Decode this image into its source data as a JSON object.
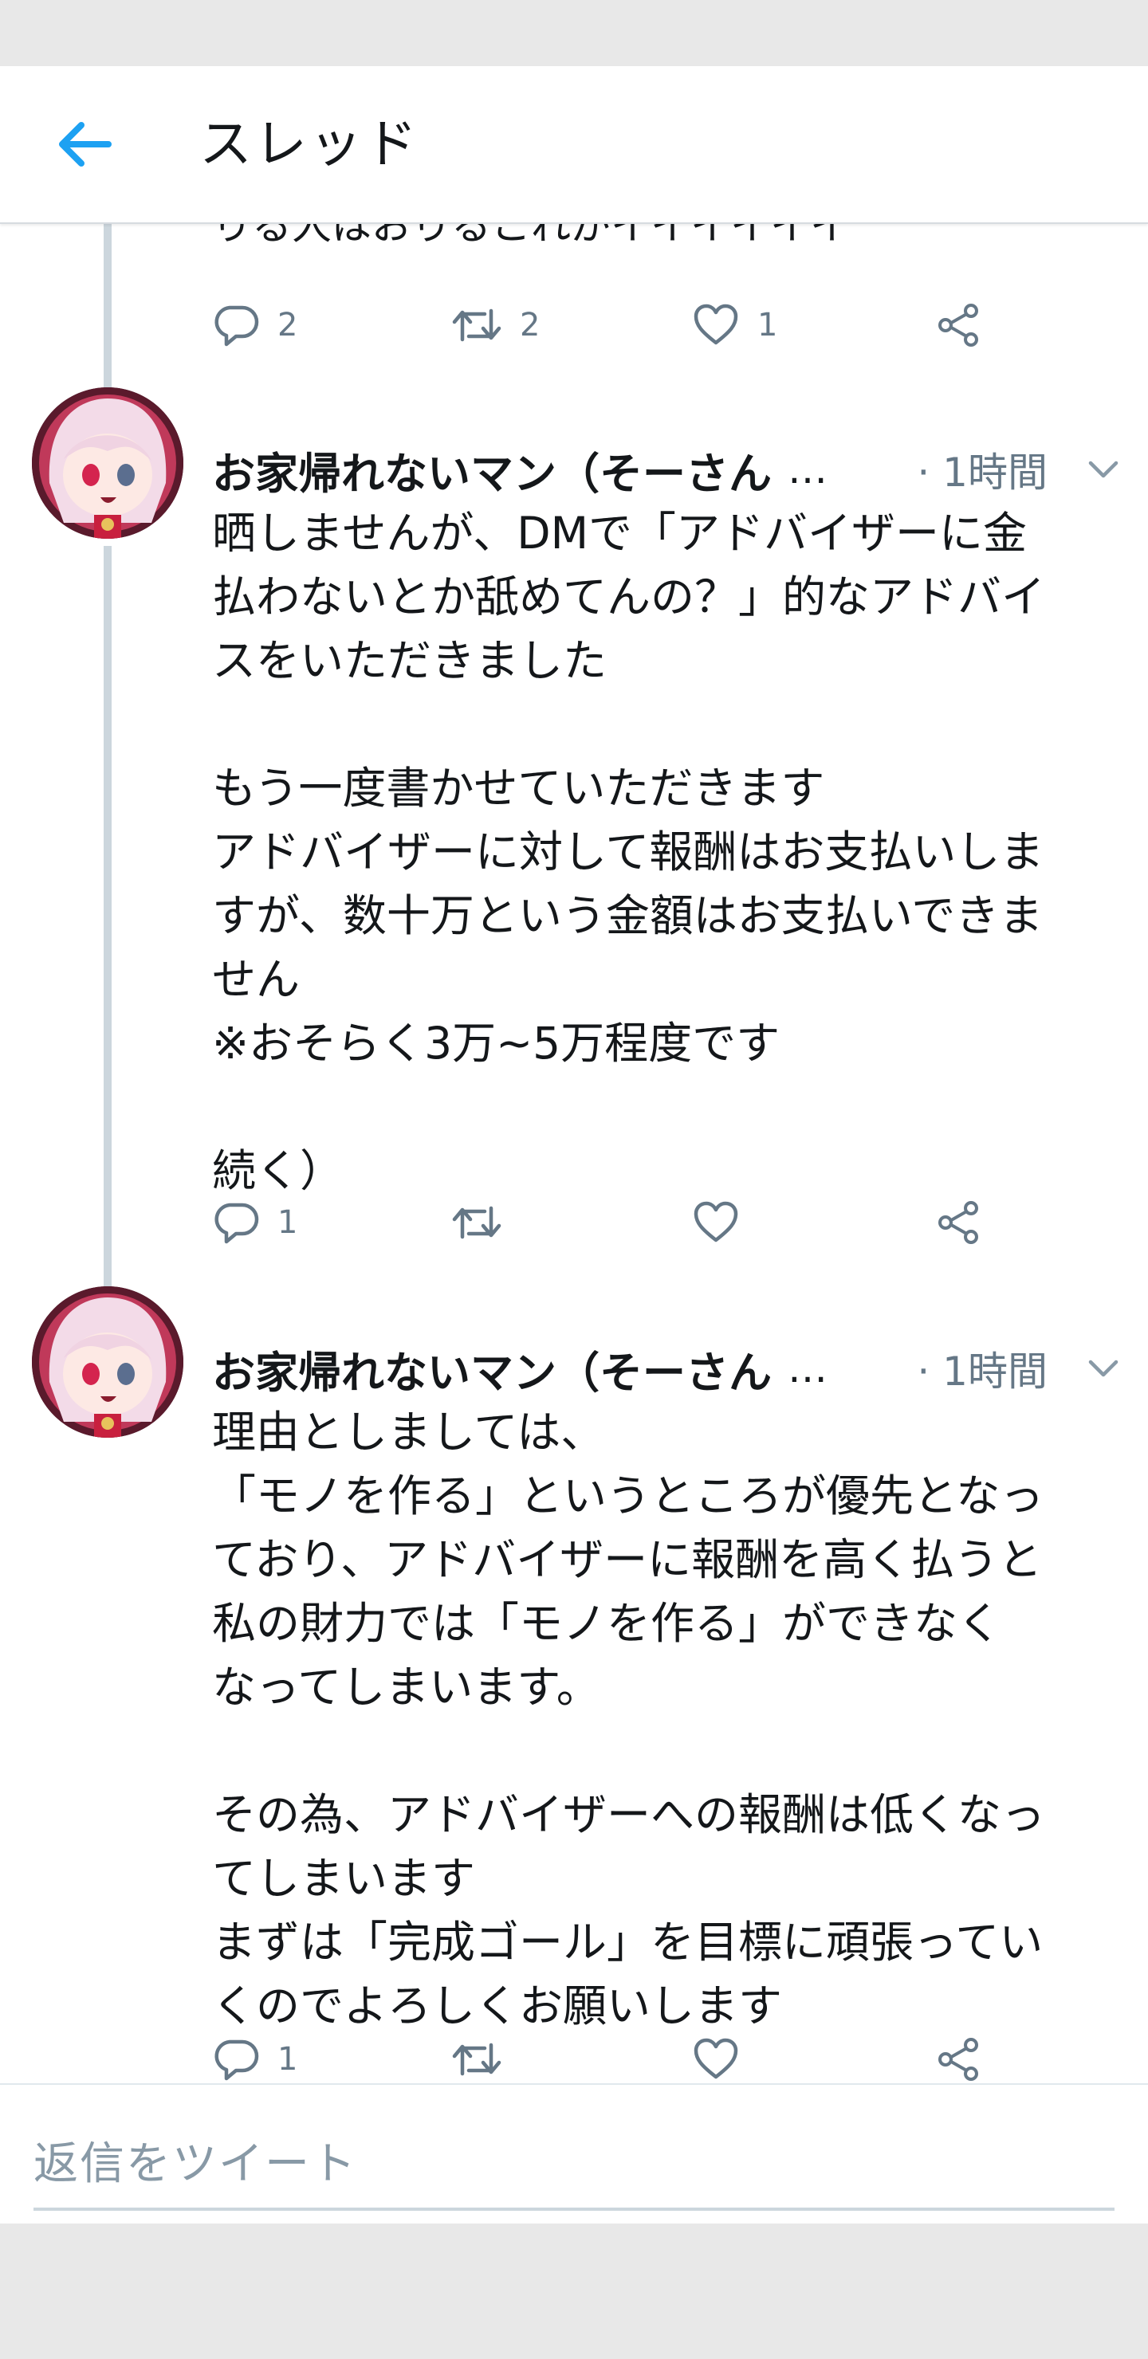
{
  "header": {
    "title": "スレッド"
  },
  "partial_tweet": {
    "cut_text": "りる人はおりるこれがイイイイイイ",
    "reply_count": "2",
    "retweet_count": "2",
    "like_count": "1"
  },
  "tweets": [
    {
      "author": "お家帰れないマン（そーさん",
      "ellipsis": "…",
      "time": "· 1時間",
      "body": "晒しませんが、DMで「アドバイザーに金\n払わないとか舐めてんの？」的なアドバイ\nスをいただきました\n\nもう一度書かせていただきます\nアドバイザーに対して報酬はお支払いしま\nすが、数十万という金額はお支払いできま\nせん\n※おそらく3万~5万程度です\n\n続く）",
      "reply_count": "1",
      "retweet_count": "",
      "like_count": ""
    },
    {
      "author": "お家帰れないマン（そーさん",
      "ellipsis": "…",
      "time": "· 1時間",
      "body": "理由としましては、\n「モノを作る」というところが優先となっ\nており、アドバイザーに報酬を高く払うと\n私の財力では「モノを作る」ができなく\nなってしまいます。\n\nその為、アドバイザーへの報酬は低くなっ\nてしまいます\nまずは「完成ゴール」を目標に頑張ってい\nくのでよろしくお願いします",
      "reply_count": "1",
      "retweet_count": "",
      "like_count": ""
    }
  ],
  "reply_box": {
    "placeholder": "返信をツイート"
  },
  "colors": {
    "accent": "#1da1f2",
    "icon_gray": "#657786",
    "thread_line": "#ccd6dd",
    "text": "#14171a"
  },
  "icons": [
    "arrow-left-icon",
    "reply-icon",
    "retweet-icon",
    "like-icon",
    "share-icon",
    "chevron-down-icon"
  ]
}
